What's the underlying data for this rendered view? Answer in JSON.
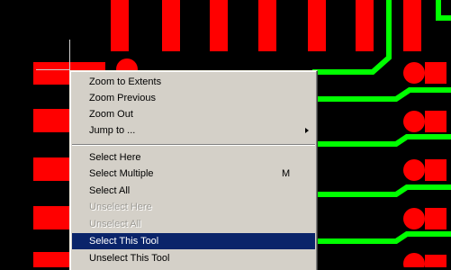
{
  "colors": {
    "canvas": "#000000",
    "pad": "#ff0000",
    "trace": "#00ff00",
    "menu_bg": "#d4d0c8",
    "highlight": "#0a246a"
  },
  "context_menu": {
    "items": [
      {
        "label": "Zoom to Extents",
        "shortcut": "",
        "enabled": true,
        "submenu": false,
        "selected": false
      },
      {
        "label": "Zoom Previous",
        "shortcut": "",
        "enabled": true,
        "submenu": false,
        "selected": false
      },
      {
        "label": "Zoom Out",
        "shortcut": "",
        "enabled": true,
        "submenu": false,
        "selected": false
      },
      {
        "label": "Jump to ...",
        "shortcut": "",
        "enabled": true,
        "submenu": true,
        "selected": false
      },
      {
        "label": "Select Here",
        "shortcut": "",
        "enabled": true,
        "submenu": false,
        "selected": false
      },
      {
        "label": "Select Multiple",
        "shortcut": "M",
        "enabled": true,
        "submenu": false,
        "selected": false
      },
      {
        "label": "Select All",
        "shortcut": "",
        "enabled": true,
        "submenu": false,
        "selected": false
      },
      {
        "label": "Unselect Here",
        "shortcut": "",
        "enabled": false,
        "submenu": false,
        "selected": false
      },
      {
        "label": "Unselect All",
        "shortcut": "",
        "enabled": false,
        "submenu": false,
        "selected": false
      },
      {
        "label": "Select This Tool",
        "shortcut": "",
        "enabled": true,
        "submenu": false,
        "selected": true
      },
      {
        "label": "Unselect This Tool",
        "shortcut": "",
        "enabled": true,
        "submenu": false,
        "selected": false
      }
    ]
  }
}
